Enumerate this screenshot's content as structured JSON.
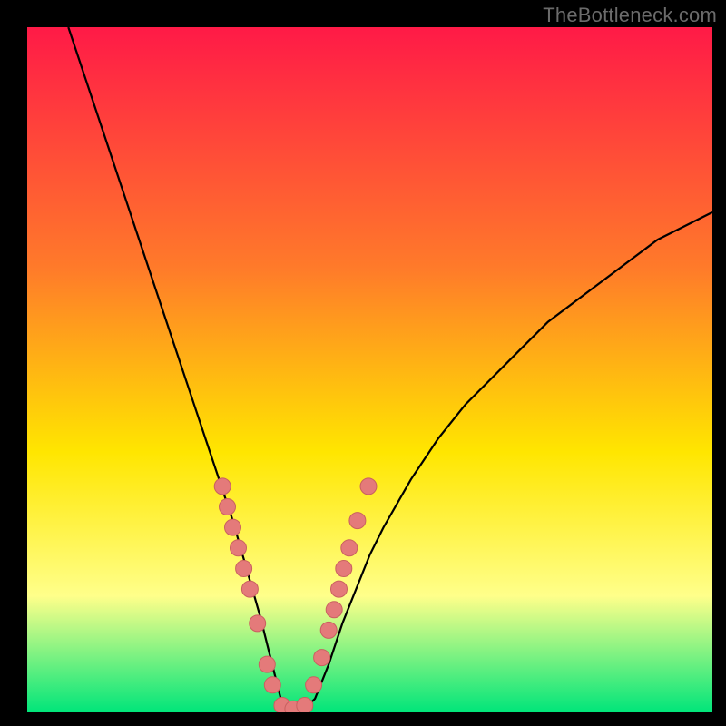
{
  "watermark": "TheBottleneck.com",
  "colors": {
    "frame_bg": "#000000",
    "gradient_top": "#ff1a47",
    "gradient_mid1": "#ff7a2a",
    "gradient_mid2": "#ffe600",
    "gradient_low": "#ffff8a",
    "gradient_bottom": "#00e57a",
    "curve": "#000000",
    "dot_fill": "#e47a7a",
    "dot_stroke": "#c96060"
  },
  "chart_data": {
    "type": "line",
    "title": "",
    "xlabel": "",
    "ylabel": "",
    "xlim": [
      0,
      100
    ],
    "ylim": [
      0,
      100
    ],
    "series": [
      {
        "name": "bottleneck-curve",
        "x": [
          6,
          8,
          10,
          12,
          14,
          16,
          18,
          20,
          22,
          24,
          26,
          28,
          30,
          32,
          34,
          36,
          37,
          38,
          39,
          40,
          42,
          44,
          46,
          48,
          50,
          52,
          56,
          60,
          64,
          68,
          72,
          76,
          80,
          84,
          88,
          92,
          96,
          100
        ],
        "y": [
          100,
          94,
          88,
          82,
          76,
          70,
          64,
          58,
          52,
          46,
          40,
          34,
          28,
          21,
          14,
          6,
          2,
          0,
          0,
          0,
          2,
          7,
          13,
          18,
          23,
          27,
          34,
          40,
          45,
          49,
          53,
          57,
          60,
          63,
          66,
          69,
          71,
          73
        ]
      }
    ],
    "scatter": [
      {
        "name": "marker-dots",
        "x": [
          28.5,
          29.2,
          30.0,
          30.8,
          31.6,
          32.5,
          33.6,
          35.0,
          35.8,
          37.2,
          38.8,
          40.5,
          41.8,
          43.0,
          44.0,
          44.8,
          45.5,
          46.2,
          47.0,
          48.2,
          49.8
        ],
        "y": [
          33,
          30,
          27,
          24,
          21,
          18,
          13,
          7,
          4,
          1,
          0.5,
          1,
          4,
          8,
          12,
          15,
          18,
          21,
          24,
          28,
          33
        ]
      }
    ]
  }
}
